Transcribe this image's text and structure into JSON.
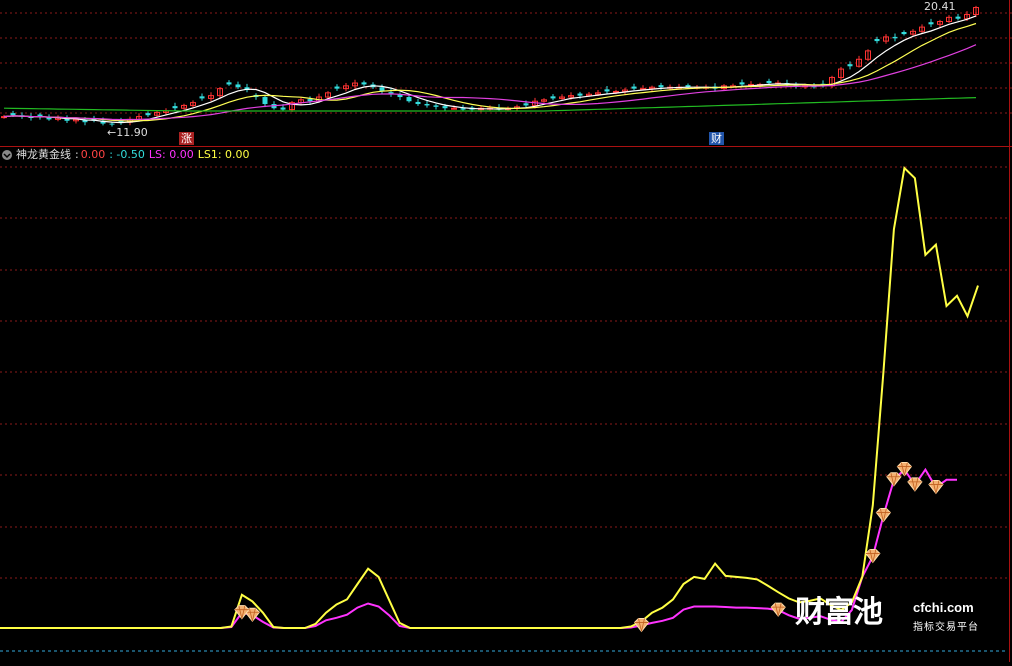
{
  "price_panel": {
    "high_label": "20.41",
    "low_label": "←11.90",
    "marker_zhang": "涨",
    "marker_cai": "财"
  },
  "indicator": {
    "name": "神龙黄金线",
    "sep": ":",
    "v1": "0.00",
    "v2": ": -0.50",
    "ls": "LS: 0.00",
    "ls1": "LS1: 0.00"
  },
  "watermark": {
    "brand": "财富池",
    "url": "cfchi.com",
    "tagline": "指标交易平台"
  },
  "colors": {
    "background": "#000000",
    "bull": "#ff3333",
    "bear": "#33dddd",
    "ma5": "#ffffff",
    "ma10": "#ffff55",
    "ma20": "#e040e0",
    "ma60": "#22bb22",
    "ls_line": "#ff33ff",
    "ls1_line": "#ffff44",
    "grid": "#8a1a1a",
    "zero_line": "#33aadd"
  },
  "chart_data": [
    {
      "type": "line",
      "name": "candlestick price panel",
      "price_range": [
        11.9,
        20.41
      ],
      "close": [
        12.5,
        12.6,
        12.5,
        12.4,
        12.5,
        12.3,
        12.4,
        12.2,
        12.3,
        12.1,
        12.2,
        12.0,
        11.95,
        12.1,
        12.3,
        12.5,
        12.6,
        12.8,
        12.9,
        13.1,
        13.3,
        13.5,
        13.8,
        14.0,
        14.5,
        14.8,
        14.6,
        14.4,
        13.9,
        13.4,
        13.1,
        13.0,
        13.5,
        13.7,
        13.6,
        13.9,
        14.2,
        14.5,
        14.7,
        14.9,
        14.8,
        14.6,
        14.3,
        14.1,
        13.9,
        13.6,
        13.4,
        13.3,
        13.2,
        13.1,
        13.1,
        13.0,
        13.0,
        13.1,
        13.1,
        13.0,
        13.1,
        13.2,
        13.3,
        13.6,
        13.7,
        13.8,
        13.9,
        14.0,
        14.0,
        14.1,
        14.2,
        14.3,
        14.3,
        14.4,
        14.5,
        14.5,
        14.6,
        14.6,
        14.6,
        14.6,
        14.6,
        14.6,
        14.6,
        14.5,
        14.7,
        14.7,
        14.8,
        14.8,
        14.8,
        14.9,
        14.9,
        14.8,
        14.7,
        14.7,
        14.6,
        14.7,
        15.3,
        15.9,
        16.1,
        16.6,
        17.2,
        17.9,
        18.2,
        18.1,
        18.4,
        18.6,
        18.9,
        19.1,
        19.3,
        19.6,
        19.5,
        19.8,
        20.3
      ],
      "ma_series": [
        "MA5",
        "MA10",
        "MA20",
        "MA60"
      ]
    },
    {
      "type": "line",
      "name": "神龙黄金线",
      "x": [
        0,
        1,
        2,
        3,
        4,
        5,
        6,
        7,
        8,
        9,
        10,
        11,
        12,
        13,
        14,
        15,
        16,
        17,
        18,
        19,
        20,
        21,
        22,
        23,
        24,
        25,
        26,
        27,
        28,
        29,
        30,
        31,
        32,
        33,
        34,
        35,
        36,
        37,
        38,
        39,
        40,
        41,
        42,
        43,
        44,
        45,
        46,
        47,
        48,
        49,
        50,
        51,
        52,
        53,
        54,
        55,
        56,
        57,
        58,
        59,
        60,
        61,
        62,
        63,
        64,
        65,
        66,
        67,
        68,
        69,
        70,
        71,
        72,
        73,
        74,
        75,
        76,
        77,
        78,
        79,
        80,
        81,
        82,
        83,
        84,
        85,
        86,
        87,
        88,
        89,
        90,
        91,
        92,
        93,
        94,
        95,
        96,
        97,
        98,
        99,
        100,
        101,
        102,
        103,
        104,
        105,
        106,
        107,
        108,
        109
      ],
      "series": [
        {
          "name": "LS1",
          "values": [
            0,
            0,
            0,
            0,
            0,
            0,
            0,
            0,
            0,
            0,
            0,
            0,
            0,
            0,
            0,
            0,
            0,
            0,
            0,
            0,
            0,
            0,
            0.3,
            6.5,
            5.2,
            3.0,
            0.2,
            0,
            0,
            0,
            0.8,
            3.0,
            4.6,
            5.6,
            8.6,
            11.6,
            10.0,
            5.5,
            1.0,
            0,
            0,
            0,
            0,
            0,
            0,
            0,
            0,
            0,
            0,
            0,
            0,
            0,
            0,
            0,
            0,
            0,
            0,
            0,
            0,
            0,
            0.3,
            1.3,
            3.0,
            4.0,
            5.6,
            8.6,
            10.0,
            9.6,
            12.6,
            10.2,
            10.0,
            9.8,
            9.5,
            8.3,
            7.0,
            5.8,
            5.0,
            5.3,
            5.8,
            4.5,
            3.5,
            5.0,
            10.0,
            24.0,
            50.0,
            78.0,
            90.0,
            88.0,
            73.0,
            75.0,
            63.0,
            65.0,
            61.0,
            67.0
          ],
          "render": "values"
        },
        {
          "name": "LS",
          "values": [
            0,
            0,
            0,
            0,
            0,
            0,
            0,
            0,
            0,
            0,
            0,
            0,
            0,
            0,
            0,
            0,
            0,
            0,
            0,
            0,
            0,
            0,
            0.2,
            3.0,
            2.5,
            1.2,
            0.1,
            0,
            0,
            0,
            0.4,
            1.5,
            2.0,
            2.6,
            4.0,
            4.8,
            4.2,
            2.5,
            0.4,
            0,
            0,
            0,
            0,
            0,
            0,
            0,
            0,
            0,
            0,
            0,
            0,
            0,
            0,
            0,
            0,
            0,
            0,
            0,
            0,
            0,
            0.1,
            0.5,
            1.0,
            1.4,
            2.0,
            3.6,
            4.2,
            4.2,
            4.2,
            4.1,
            4.0,
            4.0,
            3.9,
            3.8,
            3.5,
            2.5,
            1.8,
            2.0,
            2.3,
            1.6,
            1.2,
            3.5,
            10.0,
            14.0,
            22.0,
            29.0,
            31.0,
            28.0,
            31.0,
            27.5,
            29.0,
            29.0
          ],
          "render": "values"
        }
      ],
      "markers_on_LS": [
        0.5,
        2.5,
        3.0,
        3.5,
        13.0,
        18.5,
        23.0,
        28.0,
        31.0,
        29.0
      ]
    }
  ]
}
